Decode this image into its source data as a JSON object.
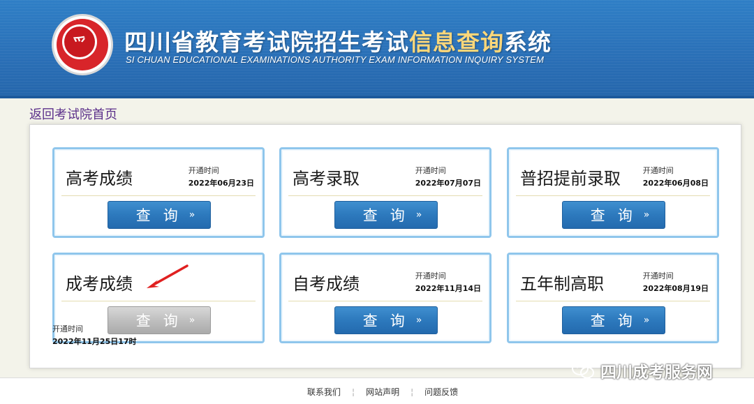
{
  "header": {
    "title_main": "四川省教育考试院招生考试",
    "title_highlight": "信息查询",
    "title_tail": "系统",
    "subtitle": "SI CHUAN EDUCATIONAL EXAMINATIONS AUTHORITY EXAM INFORMATION INQUIRY SYSTEM",
    "logo_icon": "exam-authority-seal"
  },
  "back_link": "返回考试院首页",
  "cards": [
    {
      "title": "高考成绩",
      "date_label": "开通时间",
      "date": "2022年06月23日",
      "button": "查询",
      "arrow": "»"
    },
    {
      "title": "高考录取",
      "date_label": "开通时间",
      "date": "2022年07月07日",
      "button": "查询",
      "arrow": "»"
    },
    {
      "title": "普招提前录取",
      "date_label": "开通时间",
      "date": "2022年06月08日",
      "button": "查询",
      "arrow": "»"
    },
    {
      "title": "成考成绩",
      "date_label": "开通时间",
      "date": "2022年11月25日17时",
      "button": "查询",
      "arrow": "»",
      "disabled": true
    },
    {
      "title": "自考成绩",
      "date_label": "开通时间",
      "date": "2022年11月14日",
      "button": "查询",
      "arrow": "»"
    },
    {
      "title": "五年制高职",
      "date_label": "开通时间",
      "date": "2022年08月19日",
      "button": "查询",
      "arrow": "»"
    }
  ],
  "footer": {
    "links": [
      "联系我们",
      "网站声明",
      "问题反馈"
    ]
  },
  "watermark": "四川成考服务网",
  "colors": {
    "header_blue": "#2a6fb6",
    "highlight_gold": "#fcd77a",
    "button_blue": "#2d79bd",
    "button_disabled": "#bfbfbf",
    "card_border": "#8fc6ec",
    "annotation_red": "#e02020"
  }
}
